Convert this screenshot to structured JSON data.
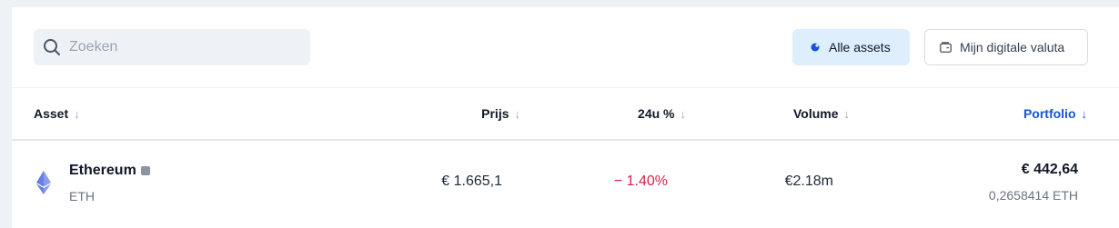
{
  "search": {
    "placeholder": "Zoeken",
    "value": ""
  },
  "filters": {
    "all_assets_label": "Alle assets",
    "my_crypto_label": "Mijn digitale valuta",
    "active": "all_assets",
    "accent_color": "#1454d8",
    "active_bg": "#deeefd"
  },
  "table": {
    "columns": [
      {
        "label": "Asset",
        "sort_icon": "arrow-down-icon"
      },
      {
        "label": "Prijs",
        "sort_icon": "arrow-down-icon"
      },
      {
        "label": "24u %",
        "sort_icon": "arrow-down-icon"
      },
      {
        "label": "Volume",
        "sort_icon": "arrow-down-icon"
      },
      {
        "label": "Portfolio",
        "sort_icon": "arrow-down-icon",
        "active": true
      }
    ],
    "rows": [
      {
        "icon": "ethereum-icon",
        "name": "Ethereum",
        "symbol": "ETH",
        "price": "€ 1.665,1",
        "change": "− 1.40%",
        "change_color": "#d81f4b",
        "volume": "€2.18m",
        "portfolio_value": "€ 442,64",
        "portfolio_amount": "0,2658414 ETH"
      }
    ]
  }
}
